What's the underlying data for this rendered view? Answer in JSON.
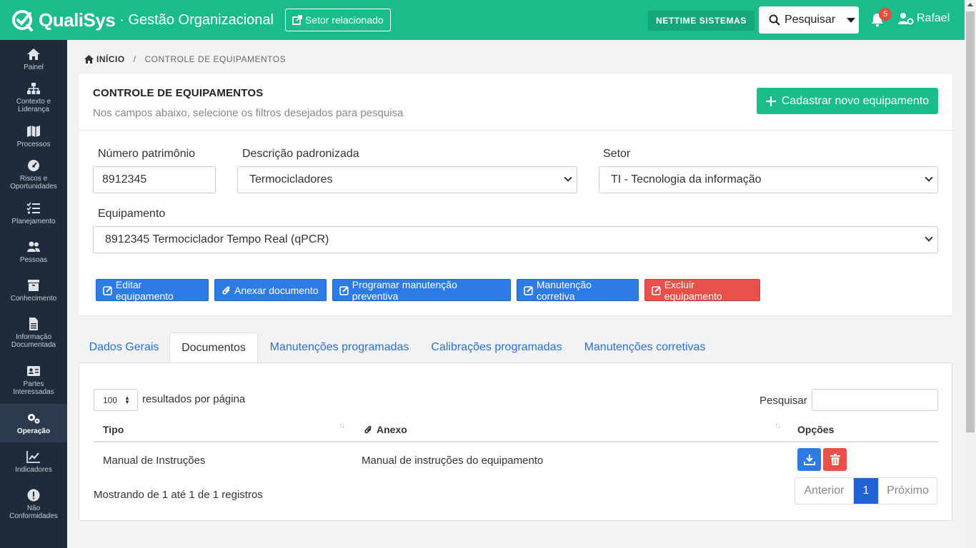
{
  "header": {
    "brand_name": "QualiSys",
    "brand_sub": "· Gestão Organizacional",
    "setor_btn": "Setor relacionado",
    "company": "NETTIME SISTEMAS",
    "search_label": "Pesquisar",
    "notif_count": "5",
    "user_name": "Rafael",
    "accent": "#1abc8c"
  },
  "sidebar": {
    "items": [
      {
        "label": "Painel",
        "icon": "home-icon"
      },
      {
        "label": "Contexto e Liderança",
        "icon": "sitemap-icon"
      },
      {
        "label": "Processos",
        "icon": "map-icon"
      },
      {
        "label": "Riscos e Oportunidades",
        "icon": "gauge-icon"
      },
      {
        "label": "Planejamento",
        "icon": "tasks-icon"
      },
      {
        "label": "Pessoas",
        "icon": "users-icon"
      },
      {
        "label": "Conhecimento",
        "icon": "archive-icon"
      },
      {
        "label": "Informação Documentada",
        "icon": "file-icon"
      },
      {
        "label": "Partes Interessadas",
        "icon": "id-card-icon"
      },
      {
        "label": "Operação",
        "icon": "gears-icon"
      },
      {
        "label": "Indicadores",
        "icon": "chart-line-icon"
      },
      {
        "label": "Não Conformidades",
        "icon": "exclamation-icon"
      }
    ]
  },
  "breadcrumb": {
    "home": "INÍCIO",
    "separator": "/",
    "current": "CONTROLE DE EQUIPAMENTOS"
  },
  "card": {
    "title": "CONTROLE DE EQUIPAMENTOS",
    "subtitle": "Nos campos abaixo, selecione os filtros desejados para pesquisa",
    "new_btn": "Cadastrar novo equipamento"
  },
  "filters": {
    "patrimonio_label": "Número patrimônio",
    "patrimonio_value": "8912345",
    "descricao_label": "Descrição padronizada",
    "descricao_value": "Termocicladores",
    "setor_label": "Setor",
    "setor_value": "TI - Tecnologia da informação",
    "equipamento_label": "Equipamento",
    "equipamento_value": "8912345 Termociclador Tempo Real (qPCR)"
  },
  "actions": {
    "editar": "Editar equipamento",
    "anexar": "Anexar documento",
    "programar": "Programar manutenção preventiva",
    "corretiva": "Manutenção corretiva",
    "excluir": "Excluir equipamento"
  },
  "tabs": [
    "Dados Gerais",
    "Documentos",
    "Manutenções programadas",
    "Calibrações programadas",
    "Manutenções corretivas"
  ],
  "table": {
    "per_page": "100",
    "per_page_label": "resultados por página",
    "search_label": "Pesquisar",
    "columns": [
      "Tipo",
      "Anexo",
      "Opções"
    ],
    "rows": [
      {
        "tipo": "Manual de Instruções",
        "anexo": "Manual de instruções do equipamento"
      }
    ],
    "info": "Mostrando de 1 até 1 de 1 registros",
    "prev": "Anterior",
    "page": "1",
    "next": "Próximo"
  }
}
